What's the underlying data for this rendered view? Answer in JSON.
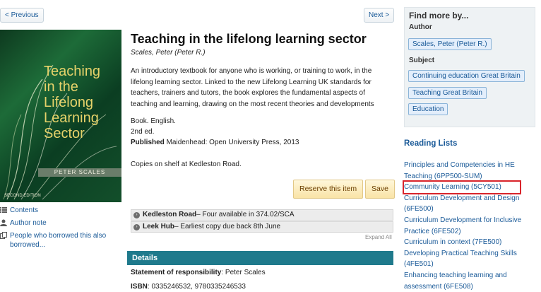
{
  "nav": {
    "previous_label": "< Previous",
    "next_label": "Next >"
  },
  "cover": {
    "title_lines": [
      "Teaching",
      "in the",
      "Lifelong",
      "Learning",
      "Sector"
    ],
    "author": "PETER SCALES",
    "edition": "SECOND EDITION"
  },
  "side_links": [
    {
      "label": "Contents",
      "icon": "list-icon"
    },
    {
      "label": "Author note",
      "icon": "person-icon"
    },
    {
      "label": "People who borrowed this also borrowed...",
      "icon": "copy-icon"
    }
  ],
  "record": {
    "title": "Teaching in the lifelong learning sector",
    "author": "Scales, Peter (Peter R.)",
    "description": "An introductory textbook for anyone who is working, or training to work, in the lifelong learning sector. Linked to the new Lifelong Learning UK standards for teachers, trainers and tutors, the book explores the fundamental aspects of teaching and learning, drawing on the most recent theories and developments",
    "format": "Book. English.",
    "edition": "2nd ed.",
    "published_label": "Published",
    "published_value": "Maidenhead: Open University Press, 2013",
    "copies_note": "Copies on shelf at Kedleston Road."
  },
  "actions": {
    "reserve_label": "Reserve this item",
    "save_label": "Save"
  },
  "holdings": [
    {
      "location": "Kedleston Road",
      "status": " – Four available in 374.02/SCA"
    },
    {
      "location": "Leek Hub",
      "status": " – Earliest copy due back 8th June"
    }
  ],
  "expand_all_label": "Expand All",
  "details": {
    "heading": "Details",
    "responsibility_label": "Statement of responsibility",
    "responsibility_value": ": Peter Scales",
    "isbn_label": "ISBN",
    "isbn_value": ": 0335246532, 9780335246533"
  },
  "find_more": {
    "heading": "Find more by...",
    "author_label": "Author",
    "authors": [
      "Scales, Peter (Peter R.)"
    ],
    "subject_label": "Subject",
    "subjects": [
      "Continuing education Great Britain",
      "Teaching Great Britain",
      "Education"
    ]
  },
  "reading_lists": {
    "heading": "Reading Lists",
    "items": [
      "Principles and Competencies in HE Teaching (6PP500-SUM)",
      "Community Learning (5CY501)",
      "Curriculum Development and Design (6FE500)",
      "Curriculum Development for Inclusive Practice (6FE502)",
      "Curriculum in context (7FE500)",
      "Developing Practical Teaching Skills (4FE501)",
      "Enhancing teaching learning and assessment (6FE508)"
    ],
    "highlighted_index": 1
  },
  "colors": {
    "link": "#1a5a98",
    "details_bar": "#1f7a8c",
    "highlight_box": "#d9242b"
  }
}
